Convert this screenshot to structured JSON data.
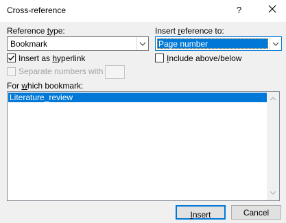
{
  "window": {
    "title": "Cross-reference",
    "help_glyph": "?"
  },
  "reference_type": {
    "label_pre": "Reference ",
    "label_key": "t",
    "label_post": "ype:",
    "value": "Bookmark"
  },
  "insert_reference_to": {
    "label_pre": "Insert ",
    "label_key": "r",
    "label_post": "eference to:",
    "value": "Page number"
  },
  "insert_as_hyperlink": {
    "label_pre": "Insert as ",
    "label_key": "h",
    "label_post": "yperlink",
    "checked": true
  },
  "include_above_below": {
    "label_pre": "",
    "label_key": "I",
    "label_post": "nclude above/below",
    "checked": false
  },
  "separate_numbers": {
    "label": "Separate numbers with",
    "checked": false,
    "enabled": false,
    "value": ""
  },
  "bookmark_list": {
    "label_pre": "For ",
    "label_key": "w",
    "label_post": "hich bookmark:",
    "items": [
      "Literature_review"
    ],
    "selected_index": 0
  },
  "buttons": {
    "insert_key": "I",
    "insert_post": "nsert",
    "cancel": "Cancel"
  },
  "colors": {
    "accent": "#0078d7",
    "dialog_bg": "#f0f0f0"
  }
}
